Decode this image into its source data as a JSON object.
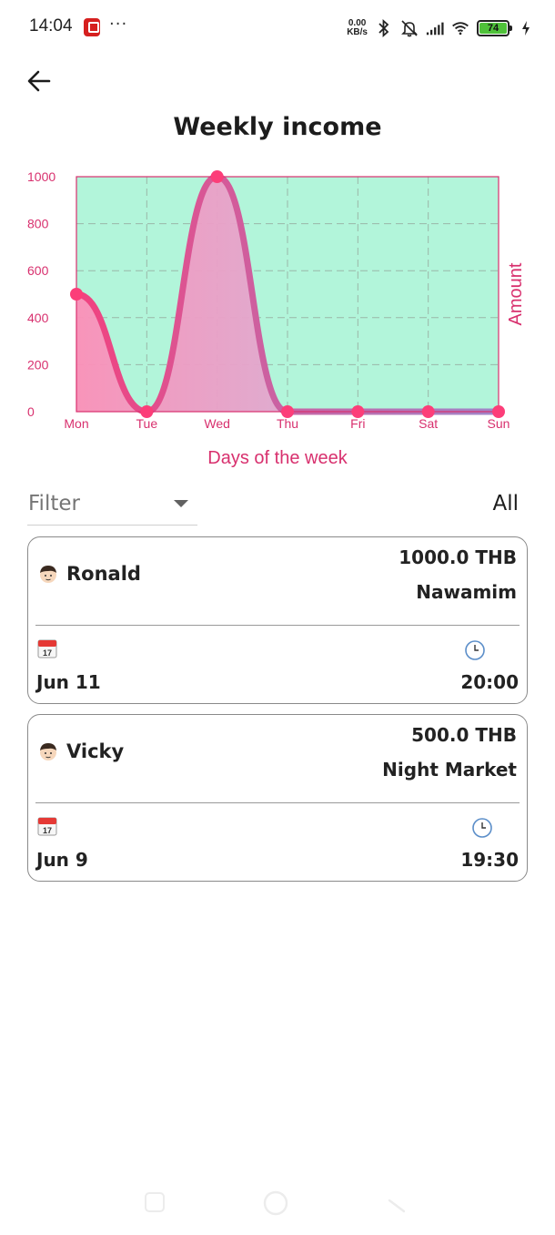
{
  "status_bar": {
    "time": "14:04",
    "more": "···",
    "net_speed_value": "0.00",
    "net_speed_unit": "KB/s",
    "battery": "74"
  },
  "header": {
    "back_icon": "arrow-left-icon"
  },
  "chart_title": "Weekly income",
  "chart_data": {
    "type": "area",
    "title": "Weekly income",
    "xlabel": "Days of the week",
    "ylabel": "Amount",
    "categories": [
      "Mon",
      "Tue",
      "Wed",
      "Thu",
      "Fri",
      "Sat",
      "Sun"
    ],
    "y_ticks": [
      "0",
      "200",
      "400",
      "600",
      "800",
      "1000"
    ],
    "ylim": [
      0,
      1000
    ],
    "series": [
      {
        "values": [
          500,
          0,
          1000,
          0,
          0,
          0,
          0
        ]
      }
    ],
    "grid": true,
    "colors": {
      "background": "#b2f5da",
      "axis_text": "#d8306e",
      "grid_line": "#9ab7a8",
      "point": "#fc3e79",
      "line_start": "#f1427f",
      "line_end": "#9f86c9",
      "fill_start": "#fc8fb8",
      "fill_end": "#c7c1e6"
    }
  },
  "filter": {
    "label": "Filter",
    "value": "All"
  },
  "transactions": [
    {
      "name": "Ronald",
      "amount": "1000.0 THB",
      "place": "Nawamim",
      "date": "Jun 11",
      "time": "20:00",
      "calendar_day": "17"
    },
    {
      "name": "Vicky",
      "amount": "500.0 THB",
      "place": "Night Market",
      "date": "Jun 9",
      "time": "19:30",
      "calendar_day": "17"
    }
  ]
}
